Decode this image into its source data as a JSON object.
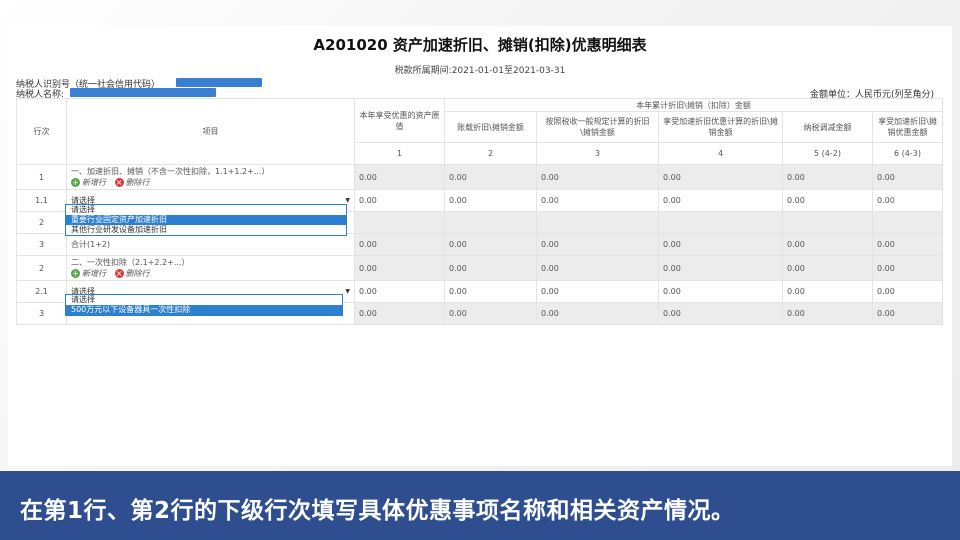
{
  "form": {
    "title": "A201020 资产加速折旧、摊销(扣除)优惠明细表",
    "period": "税款所属期间:2021-01-01至2021-03-31",
    "taxpayer_id_label": "纳税人识别号（统一社会信用代码）",
    "taxpayer_name_label": "纳税人名称:",
    "unit": "金额单位：人民币元(列至角分)"
  },
  "table": {
    "headers": {
      "row_no": "行次",
      "item": "项目",
      "original_value": "本年享受优惠的资产原值",
      "group": "本年累计折旧\\摊销（扣除）金额",
      "col2": "账载折旧\\摊销金额",
      "col3": "按照税收一般规定计算的折旧\\摊销金额",
      "col4": "享受加速折旧优惠计算的折旧\\摊销金额",
      "col5": "纳税调减金额",
      "col6": "享受加速折旧\\摊销优惠金额"
    },
    "col_numbers": [
      "1",
      "2",
      "3",
      "4",
      "5 (4-2)",
      "6 (4-3)"
    ],
    "rows": [
      {
        "no": "1",
        "item": "一、加速折旧、摊销（不含一次性扣除，1.1+1.2+...）",
        "values": [
          "0.00",
          "0.00",
          "0.00",
          "0.00",
          "0.00",
          "0.00"
        ]
      },
      {
        "no": "1.1",
        "item": "请选择",
        "values": [
          "0.00",
          "0.00",
          "0.00",
          "0.00",
          "0.00",
          "0.00"
        ]
      },
      {
        "no": "2",
        "item": "",
        "values": [
          "",
          "",
          "",
          "",
          "",
          ""
        ]
      },
      {
        "no": "3",
        "item": "合计(1+2)",
        "values": [
          "0.00",
          "0.00",
          "0.00",
          "0.00",
          "0.00",
          "0.00"
        ]
      },
      {
        "no": "2",
        "item": "二、一次性扣除（2.1+2.2+...）",
        "values": [
          "0.00",
          "0.00",
          "0.00",
          "0.00",
          "0.00",
          "0.00"
        ]
      },
      {
        "no": "2.1",
        "item": "请选择",
        "values": [
          "0.00",
          "0.00",
          "0.00",
          "0.00",
          "0.00",
          "0.00"
        ]
      },
      {
        "no": "3",
        "item": "",
        "values": [
          "0.00",
          "0.00",
          "0.00",
          "0.00",
          "0.00",
          "0.00"
        ]
      }
    ],
    "actions": {
      "add": "新增行",
      "delete": "删除行"
    }
  },
  "dropdown1": {
    "options": [
      "请选择",
      "重要行业固定资产加速折旧",
      "其他行业研发设备加速折旧"
    ],
    "selected_index": 1
  },
  "dropdown2": {
    "options": [
      "请选择",
      "500万元以下设备器具一次性扣除"
    ],
    "selected_index": 1
  },
  "banner": {
    "text": "在第1行、第2行的下级行次填写具体优惠事项名称和相关资产情况。"
  }
}
